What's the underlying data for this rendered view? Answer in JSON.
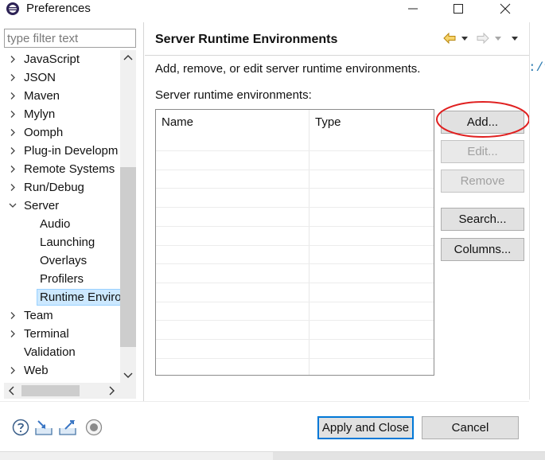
{
  "window": {
    "title": "Preferences"
  },
  "filter": {
    "placeholder": "type filter text"
  },
  "tree": {
    "items": [
      {
        "label": "JavaScript",
        "expander": "collapsed",
        "indent": 0
      },
      {
        "label": "JSON",
        "expander": "collapsed",
        "indent": 0
      },
      {
        "label": "Maven",
        "expander": "collapsed",
        "indent": 0
      },
      {
        "label": "Mylyn",
        "expander": "collapsed",
        "indent": 0
      },
      {
        "label": "Oomph",
        "expander": "collapsed",
        "indent": 0
      },
      {
        "label": "Plug-in Developm",
        "expander": "collapsed",
        "indent": 0
      },
      {
        "label": "Remote Systems",
        "expander": "collapsed",
        "indent": 0
      },
      {
        "label": "Run/Debug",
        "expander": "collapsed",
        "indent": 0
      },
      {
        "label": "Server",
        "expander": "expanded",
        "indent": 0
      },
      {
        "label": "Audio",
        "expander": "none",
        "indent": 1
      },
      {
        "label": "Launching",
        "expander": "none",
        "indent": 1
      },
      {
        "label": "Overlays",
        "expander": "none",
        "indent": 1
      },
      {
        "label": "Profilers",
        "expander": "none",
        "indent": 1
      },
      {
        "label": "Runtime Enviro",
        "expander": "none",
        "indent": 1,
        "selected": true
      },
      {
        "label": "Team",
        "expander": "collapsed",
        "indent": 0
      },
      {
        "label": "Terminal",
        "expander": "collapsed",
        "indent": 0
      },
      {
        "label": "Validation",
        "expander": "none",
        "indent": 0
      },
      {
        "label": "Web",
        "expander": "collapsed",
        "indent": 0
      }
    ]
  },
  "page": {
    "title": "Server Runtime Environments",
    "description": "Add, remove, or edit server runtime environments.",
    "list_label": "Server runtime environments:",
    "table": {
      "columns": [
        "Name",
        "Type"
      ],
      "rows": []
    },
    "buttons": {
      "add": "Add...",
      "edit": "Edit...",
      "remove": "Remove",
      "search": "Search...",
      "columns": "Columns..."
    },
    "highlight_color": "#e02020",
    "peek_text": ":/t"
  },
  "footer": {
    "apply_close": "Apply and Close",
    "cancel": "Cancel",
    "icons": [
      "help-icon",
      "import-icon",
      "export-icon",
      "record-icon"
    ]
  },
  "colors": {
    "selection_bg": "#cce8ff",
    "default_button_border": "#0078d7"
  }
}
